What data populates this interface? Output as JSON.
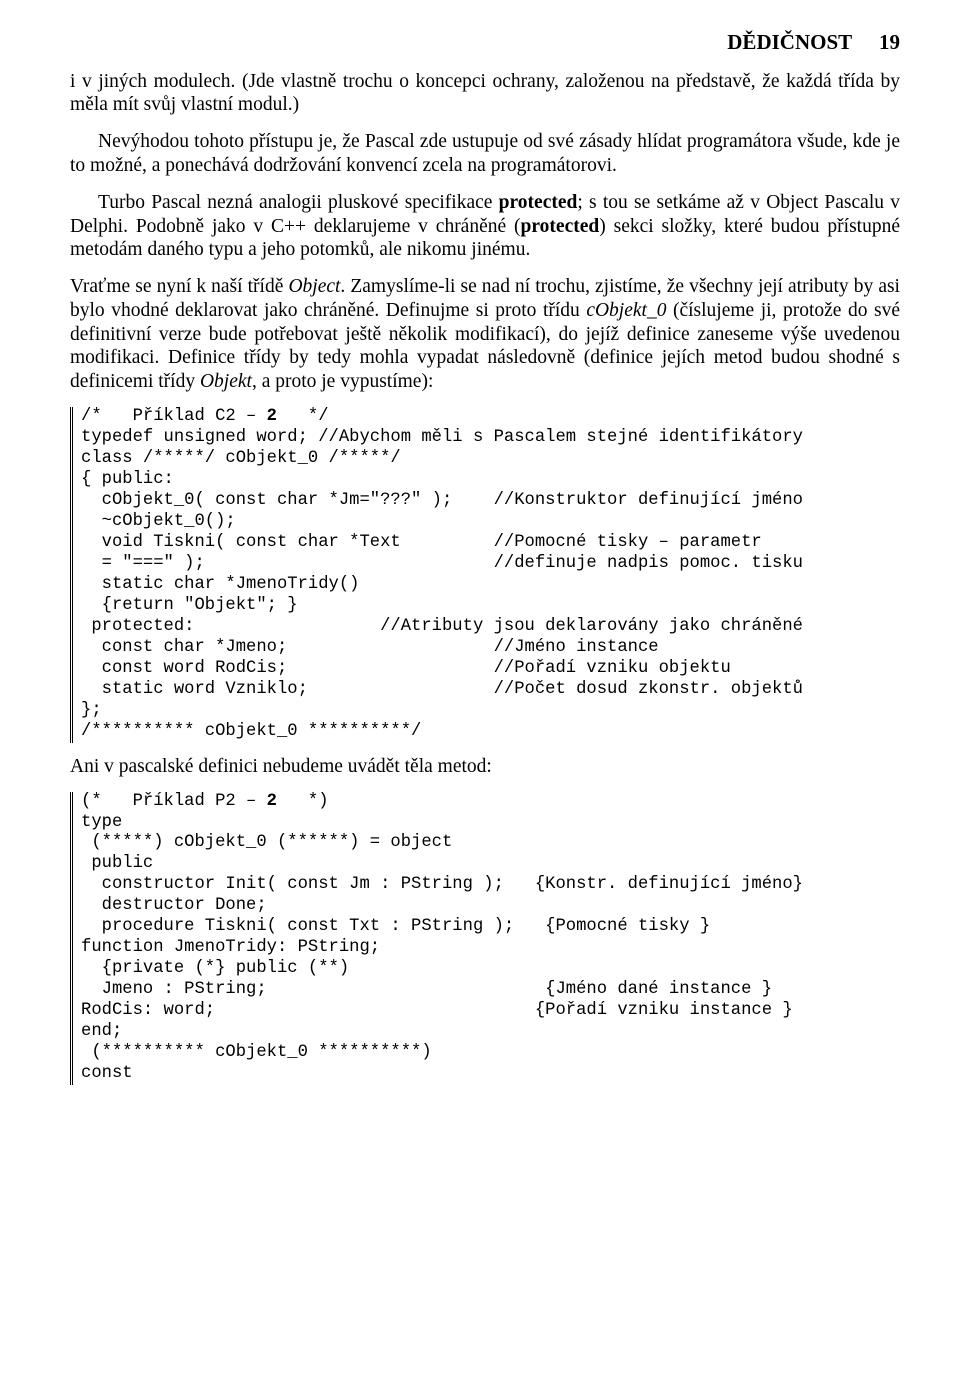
{
  "header": {
    "title": "DĚDIČNOST",
    "page": "19"
  },
  "paragraphs": {
    "p1": "i v jiných modulech. (Jde vlastně trochu o koncepci ochrany, založenou na představě, že každá třída by měla mít svůj vlastní modul.)",
    "p2a": "Nevýhodou tohoto přístupu je, že Pascal zde ustupuje od své zásady hlídat programátora všude, kde je to možné, a ponechává dodržování konvencí zcela na programátorovi.",
    "p2b_pre": "Turbo Pascal nezná analogii pluskové specifikace ",
    "p2b_kw": "protected",
    "p2b_mid": "; s tou se setkáme až v Object Pascalu v Delphi. Podobně jako v C++ deklarujeme v chráněné (",
    "p2b_kw2": "protected",
    "p2b_post": ") sekci složky, které budou přístupné metodám daného typu a jeho potomků, ale nikomu jinému.",
    "p3_pre": "Vraťme se nyní k naší třídě ",
    "p3_it1": "Object",
    "p3_mid1": ". Zamyslíme-li se nad ní trochu, zjistíme, že všechny její atributy by asi bylo vhodné deklarovat jako chráněné. Definujme si proto třídu ",
    "p3_it2": "cObjekt_0",
    "p3_mid2": " (číslujeme ji, protože do své definitivní verze bude potřebovat ještě několik modifikací), do jejíž definice zaneseme výše uvedenou modifikaci. Definice třídy by tedy mohla vypadat následovně (definice jejích metod budou shodné s definicemi třídy ",
    "p3_it3": "Objekt",
    "p3_post": ", a proto je vypustíme):",
    "p4": "Ani v pascalské definici nebudeme uvádět těla metod:"
  },
  "code1": "/*   Příklad C2 – <b>2</b>   */\ntypedef unsigned word; //Abychom měli s Pascalem stejné identifikátory\nclass /*****/ cObjekt_0 /*****/\n{ public:\n  cObjekt_0( const char *Jm=\"???\" );    //Konstruktor definující jméno\n  ~cObjekt_0();\n  void Tiskni( const char *Text         //Pomocné tisky – parametr\n  = \"===\" );                            //definuje nadpis pomoc. tisku\n  static char *JmenoTridy()\n  {return \"Objekt\"; }\n protected:                  //Atributy jsou deklarovány jako chráněné\n  const char *Jmeno;                    //Jméno instance\n  const word RodCis;                    //Pořadí vzniku objektu\n  static word Vzniklo;                  //Počet dosud zkonstr. objektů\n};\n/********** cObjekt_0 **********/",
  "code2": "(*   Příklad P2 – <b>2</b>   *)\ntype\n (*****) cObjekt_0 (******) = object\n public\n  constructor Init( const Jm : PString );   {Konstr. definující jméno}\n  destructor Done;\n  procedure Tiskni( const Txt : PString );   {Pomocné tisky }\nfunction JmenoTridy: PString;\n  {private (*} public (**)\n  Jmeno : PString;                           {Jméno dané instance }\nRodCis: word;                               {Pořadí vzniku instance }\nend;\n (********** cObjekt_0 **********)\nconst"
}
